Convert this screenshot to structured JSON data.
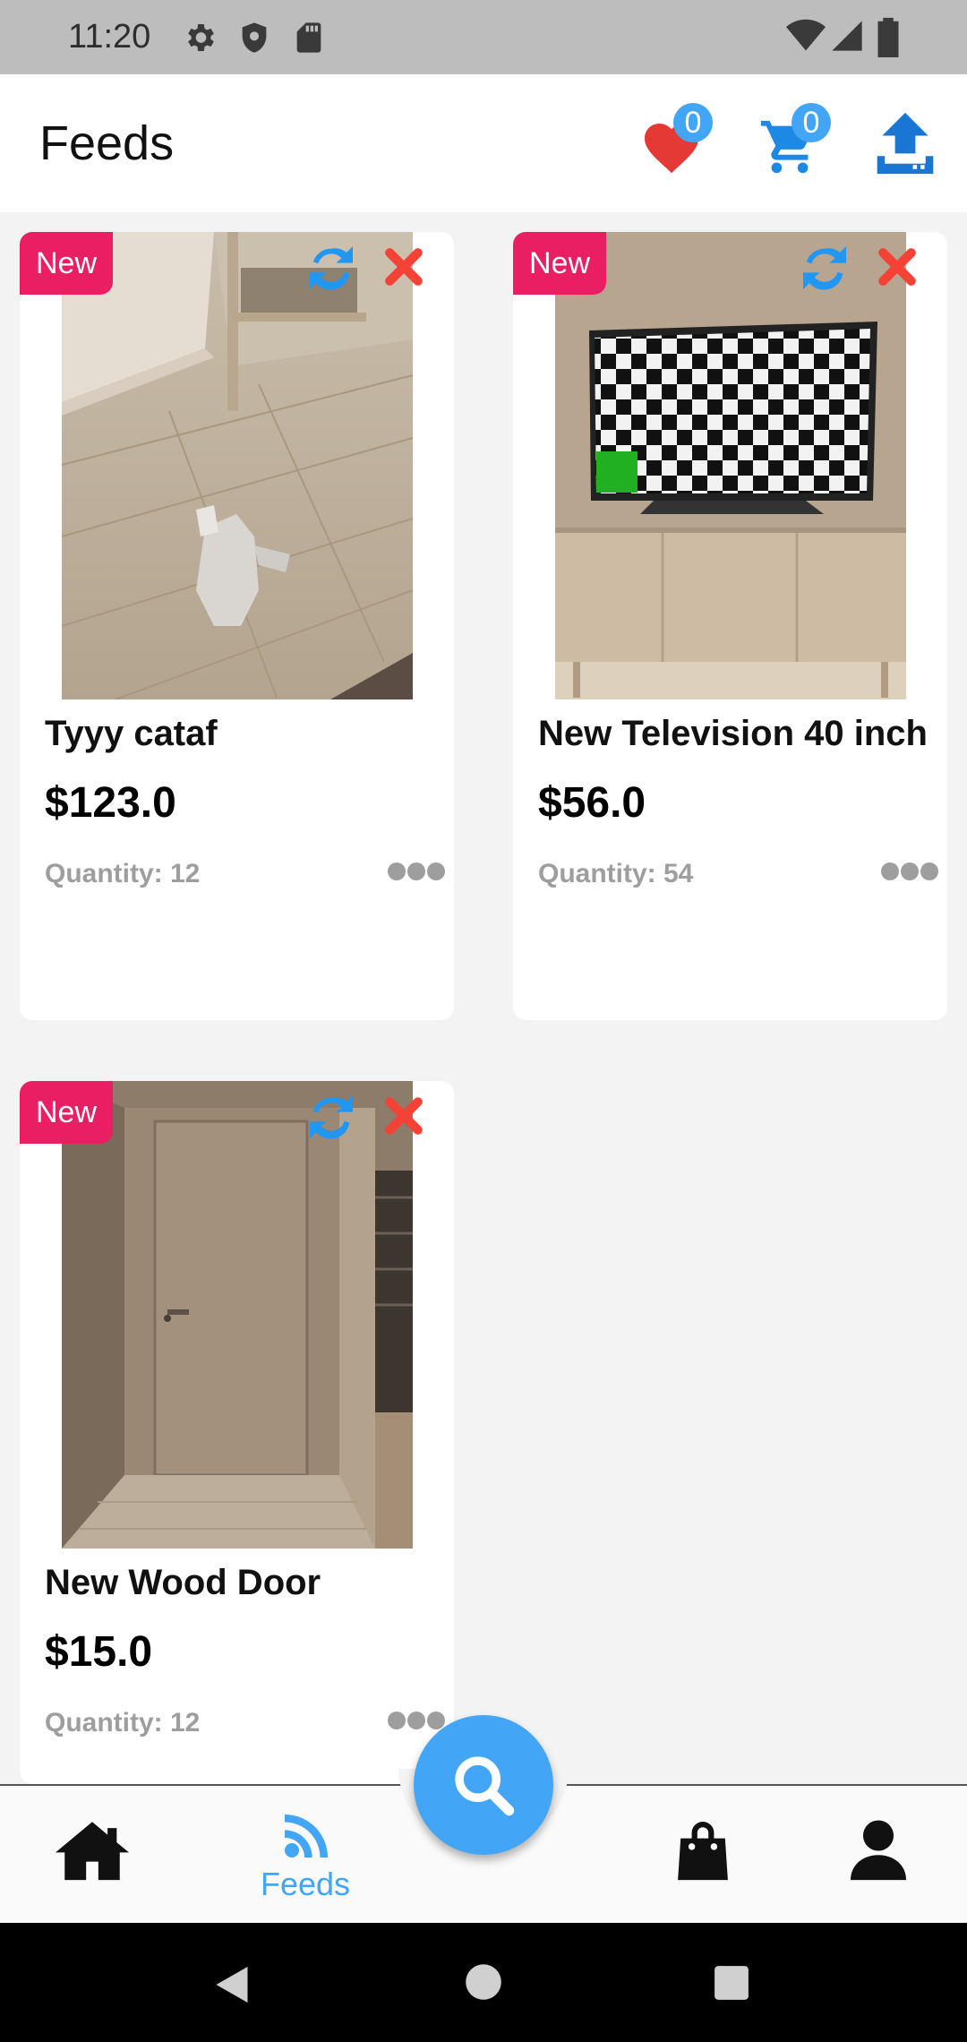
{
  "status_bar": {
    "time": "11:20",
    "icons": [
      "settings-icon",
      "shield-icon",
      "sd-card-icon",
      "wifi-icon",
      "signal-icon",
      "battery-icon"
    ]
  },
  "app_bar": {
    "title": "Feeds",
    "wishlist_count": "0",
    "cart_count": "0",
    "icons": [
      "heart-icon",
      "cart-icon",
      "upload-icon"
    ]
  },
  "products": [
    {
      "tag": "New",
      "name": "Tyyy cataf",
      "price": "$123.0",
      "quantity": "Quantity: 12"
    },
    {
      "tag": "New",
      "name": "New Television 40 inch",
      "price": "$56.0",
      "quantity": "Quantity: 54"
    },
    {
      "tag": "New",
      "name": "New Wood Door",
      "price": "$15.0",
      "quantity": "Quantity: 12"
    }
  ],
  "bottom_nav": {
    "items": [
      "home-icon",
      "feeds-icon",
      "search-icon",
      "bag-icon",
      "user-icon"
    ],
    "active_label": "Feeds"
  },
  "colors": {
    "accent": "#42a5f5",
    "tag": "#e91e63",
    "remove": "#f44336",
    "heart": "#e53935",
    "upload": "#1976d2"
  }
}
